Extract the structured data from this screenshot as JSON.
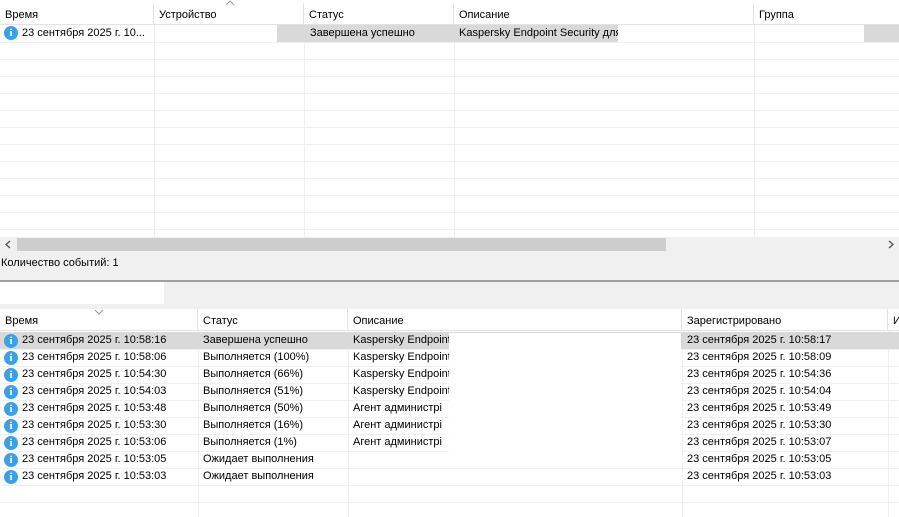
{
  "top_table": {
    "columns": [
      "Время",
      "Устройство",
      "Статус",
      "Описание",
      "Группа"
    ],
    "rows": [
      {
        "time": "23 сентября 2025 г. 10...",
        "device": "",
        "status": "Завершена успешно",
        "description": "Kaspersky Endpoint Security для",
        "group": ""
      }
    ]
  },
  "status_bar": {
    "event_count": "Количество событий: 1"
  },
  "bottom_table": {
    "columns": [
      "Время",
      "Статус",
      "Описание",
      "Зарегистрировано",
      "И"
    ],
    "rows": [
      {
        "time": "23 сентября 2025 г. 10:58:16",
        "status": "Завершена успешно",
        "description": "Kaspersky Endpoint",
        "registered": "23 сентября 2025 г. 10:58:17"
      },
      {
        "time": "23 сентября 2025 г. 10:58:06",
        "status": "Выполняется (100%)",
        "description": "Kaspersky Endpoint",
        "registered": "23 сентября 2025 г. 10:58:09"
      },
      {
        "time": "23 сентября 2025 г. 10:54:30",
        "status": "Выполняется (66%)",
        "description": "Kaspersky Endpoint",
        "registered": "23 сентября 2025 г. 10:54:36"
      },
      {
        "time": "23 сентября 2025 г. 10:54:03",
        "status": "Выполняется (51%)",
        "description": "Kaspersky Endpoint",
        "registered": "23 сентября 2025 г. 10:54:04"
      },
      {
        "time": "23 сентября 2025 г. 10:53:48",
        "status": "Выполняется (50%)",
        "description": "Агент администрі",
        "registered": "23 сентября 2025 г. 10:53:49"
      },
      {
        "time": "23 сентября 2025 г. 10:53:30",
        "status": "Выполняется (16%)",
        "description": "Агент администрі",
        "registered": "23 сентября 2025 г. 10:53:30"
      },
      {
        "time": "23 сентября 2025 г. 10:53:06",
        "status": "Выполняется (1%)",
        "description": "Агент администрі",
        "registered": "23 сентября 2025 г. 10:53:07"
      },
      {
        "time": "23 сентября 2025 г. 10:53:05",
        "status": "Ожидает выполнения",
        "description": "",
        "registered": "23 сентября 2025 г. 10:53:05"
      },
      {
        "time": "23 сентября 2025 г. 10:53:03",
        "status": "Ожидает выполнения",
        "description": "",
        "registered": "23 сентября 2025 г. 10:53:03"
      }
    ]
  },
  "icons": {
    "row_icon": "info-icon",
    "scroll_left": "chevron-left-icon",
    "scroll_right": "chevron-right-icon"
  },
  "colors": {
    "selection": "#d9d9d9",
    "info": "#3aa0e8"
  }
}
